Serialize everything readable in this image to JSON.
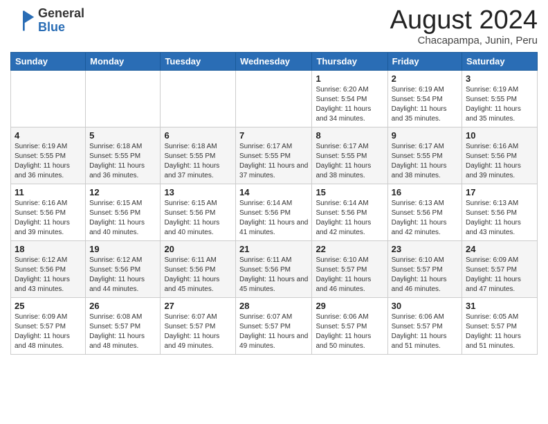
{
  "header": {
    "logo_general": "General",
    "logo_blue": "Blue",
    "month_year": "August 2024",
    "location": "Chacapampa, Junin, Peru"
  },
  "weekdays": [
    "Sunday",
    "Monday",
    "Tuesday",
    "Wednesday",
    "Thursday",
    "Friday",
    "Saturday"
  ],
  "weeks": [
    [
      {
        "day": "",
        "sunrise": "",
        "sunset": "",
        "daylight": ""
      },
      {
        "day": "",
        "sunrise": "",
        "sunset": "",
        "daylight": ""
      },
      {
        "day": "",
        "sunrise": "",
        "sunset": "",
        "daylight": ""
      },
      {
        "day": "",
        "sunrise": "",
        "sunset": "",
        "daylight": ""
      },
      {
        "day": "1",
        "sunrise": "Sunrise: 6:20 AM",
        "sunset": "Sunset: 5:54 PM",
        "daylight": "Daylight: 11 hours and 34 minutes."
      },
      {
        "day": "2",
        "sunrise": "Sunrise: 6:19 AM",
        "sunset": "Sunset: 5:54 PM",
        "daylight": "Daylight: 11 hours and 35 minutes."
      },
      {
        "day": "3",
        "sunrise": "Sunrise: 6:19 AM",
        "sunset": "Sunset: 5:55 PM",
        "daylight": "Daylight: 11 hours and 35 minutes."
      }
    ],
    [
      {
        "day": "4",
        "sunrise": "Sunrise: 6:19 AM",
        "sunset": "Sunset: 5:55 PM",
        "daylight": "Daylight: 11 hours and 36 minutes."
      },
      {
        "day": "5",
        "sunrise": "Sunrise: 6:18 AM",
        "sunset": "Sunset: 5:55 PM",
        "daylight": "Daylight: 11 hours and 36 minutes."
      },
      {
        "day": "6",
        "sunrise": "Sunrise: 6:18 AM",
        "sunset": "Sunset: 5:55 PM",
        "daylight": "Daylight: 11 hours and 37 minutes."
      },
      {
        "day": "7",
        "sunrise": "Sunrise: 6:17 AM",
        "sunset": "Sunset: 5:55 PM",
        "daylight": "Daylight: 11 hours and 37 minutes."
      },
      {
        "day": "8",
        "sunrise": "Sunrise: 6:17 AM",
        "sunset": "Sunset: 5:55 PM",
        "daylight": "Daylight: 11 hours and 38 minutes."
      },
      {
        "day": "9",
        "sunrise": "Sunrise: 6:17 AM",
        "sunset": "Sunset: 5:55 PM",
        "daylight": "Daylight: 11 hours and 38 minutes."
      },
      {
        "day": "10",
        "sunrise": "Sunrise: 6:16 AM",
        "sunset": "Sunset: 5:56 PM",
        "daylight": "Daylight: 11 hours and 39 minutes."
      }
    ],
    [
      {
        "day": "11",
        "sunrise": "Sunrise: 6:16 AM",
        "sunset": "Sunset: 5:56 PM",
        "daylight": "Daylight: 11 hours and 39 minutes."
      },
      {
        "day": "12",
        "sunrise": "Sunrise: 6:15 AM",
        "sunset": "Sunset: 5:56 PM",
        "daylight": "Daylight: 11 hours and 40 minutes."
      },
      {
        "day": "13",
        "sunrise": "Sunrise: 6:15 AM",
        "sunset": "Sunset: 5:56 PM",
        "daylight": "Daylight: 11 hours and 40 minutes."
      },
      {
        "day": "14",
        "sunrise": "Sunrise: 6:14 AM",
        "sunset": "Sunset: 5:56 PM",
        "daylight": "Daylight: 11 hours and 41 minutes."
      },
      {
        "day": "15",
        "sunrise": "Sunrise: 6:14 AM",
        "sunset": "Sunset: 5:56 PM",
        "daylight": "Daylight: 11 hours and 42 minutes."
      },
      {
        "day": "16",
        "sunrise": "Sunrise: 6:13 AM",
        "sunset": "Sunset: 5:56 PM",
        "daylight": "Daylight: 11 hours and 42 minutes."
      },
      {
        "day": "17",
        "sunrise": "Sunrise: 6:13 AM",
        "sunset": "Sunset: 5:56 PM",
        "daylight": "Daylight: 11 hours and 43 minutes."
      }
    ],
    [
      {
        "day": "18",
        "sunrise": "Sunrise: 6:12 AM",
        "sunset": "Sunset: 5:56 PM",
        "daylight": "Daylight: 11 hours and 43 minutes."
      },
      {
        "day": "19",
        "sunrise": "Sunrise: 6:12 AM",
        "sunset": "Sunset: 5:56 PM",
        "daylight": "Daylight: 11 hours and 44 minutes."
      },
      {
        "day": "20",
        "sunrise": "Sunrise: 6:11 AM",
        "sunset": "Sunset: 5:56 PM",
        "daylight": "Daylight: 11 hours and 45 minutes."
      },
      {
        "day": "21",
        "sunrise": "Sunrise: 6:11 AM",
        "sunset": "Sunset: 5:56 PM",
        "daylight": "Daylight: 11 hours and 45 minutes."
      },
      {
        "day": "22",
        "sunrise": "Sunrise: 6:10 AM",
        "sunset": "Sunset: 5:57 PM",
        "daylight": "Daylight: 11 hours and 46 minutes."
      },
      {
        "day": "23",
        "sunrise": "Sunrise: 6:10 AM",
        "sunset": "Sunset: 5:57 PM",
        "daylight": "Daylight: 11 hours and 46 minutes."
      },
      {
        "day": "24",
        "sunrise": "Sunrise: 6:09 AM",
        "sunset": "Sunset: 5:57 PM",
        "daylight": "Daylight: 11 hours and 47 minutes."
      }
    ],
    [
      {
        "day": "25",
        "sunrise": "Sunrise: 6:09 AM",
        "sunset": "Sunset: 5:57 PM",
        "daylight": "Daylight: 11 hours and 48 minutes."
      },
      {
        "day": "26",
        "sunrise": "Sunrise: 6:08 AM",
        "sunset": "Sunset: 5:57 PM",
        "daylight": "Daylight: 11 hours and 48 minutes."
      },
      {
        "day": "27",
        "sunrise": "Sunrise: 6:07 AM",
        "sunset": "Sunset: 5:57 PM",
        "daylight": "Daylight: 11 hours and 49 minutes."
      },
      {
        "day": "28",
        "sunrise": "Sunrise: 6:07 AM",
        "sunset": "Sunset: 5:57 PM",
        "daylight": "Daylight: 11 hours and 49 minutes."
      },
      {
        "day": "29",
        "sunrise": "Sunrise: 6:06 AM",
        "sunset": "Sunset: 5:57 PM",
        "daylight": "Daylight: 11 hours and 50 minutes."
      },
      {
        "day": "30",
        "sunrise": "Sunrise: 6:06 AM",
        "sunset": "Sunset: 5:57 PM",
        "daylight": "Daylight: 11 hours and 51 minutes."
      },
      {
        "day": "31",
        "sunrise": "Sunrise: 6:05 AM",
        "sunset": "Sunset: 5:57 PM",
        "daylight": "Daylight: 11 hours and 51 minutes."
      }
    ]
  ]
}
